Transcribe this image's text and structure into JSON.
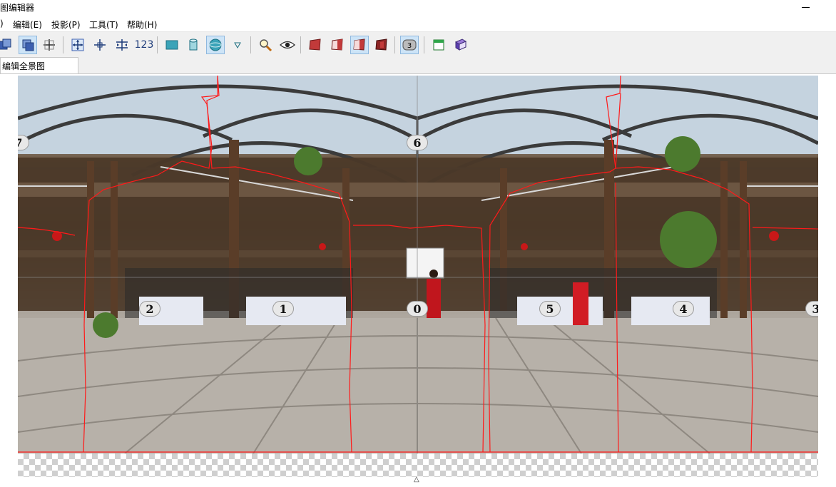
{
  "window": {
    "title": "景图编辑器"
  },
  "menu": {
    "items": [
      ")",
      "编辑(E)",
      "投影(P)",
      "工具(T)",
      "帮助(H)"
    ]
  },
  "toolbar": {
    "zoom_label": "123",
    "active_tools": [
      "select-front",
      "sphere-projection",
      "portal-3",
      "show-markers"
    ]
  },
  "tabs": [
    {
      "label": "编辑全景图",
      "selected": true
    }
  ],
  "pano": {
    "markers": [
      "7",
      "6",
      "2",
      "1",
      "0",
      "5",
      "4",
      "3"
    ]
  },
  "colors": {
    "seam_line": "#ff0000",
    "active_button": "#cde4f7"
  }
}
